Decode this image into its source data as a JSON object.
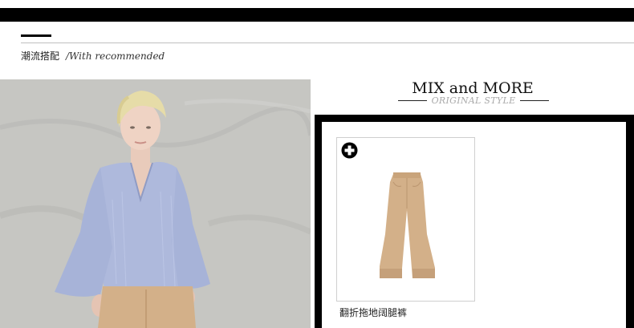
{
  "section": {
    "title_zh": "潮流搭配",
    "title_en": "/With recommended"
  },
  "lookbook": {
    "alt": "model wearing light blue striped flare-sleeve V-neck blouse with tan wide-leg trousers"
  },
  "mix": {
    "title": "MIX and MORE",
    "subtitle": "ORIGINAL STYLE"
  },
  "products": [
    {
      "name": "翻折拖地阔腿裤",
      "icon": "plus-circle-icon",
      "color": "#d3b089"
    }
  ],
  "colors": {
    "frame": "#000000",
    "pants": "#d3b089",
    "shirt": "#aeb9dc",
    "backdrop": "#c6c6c2"
  }
}
